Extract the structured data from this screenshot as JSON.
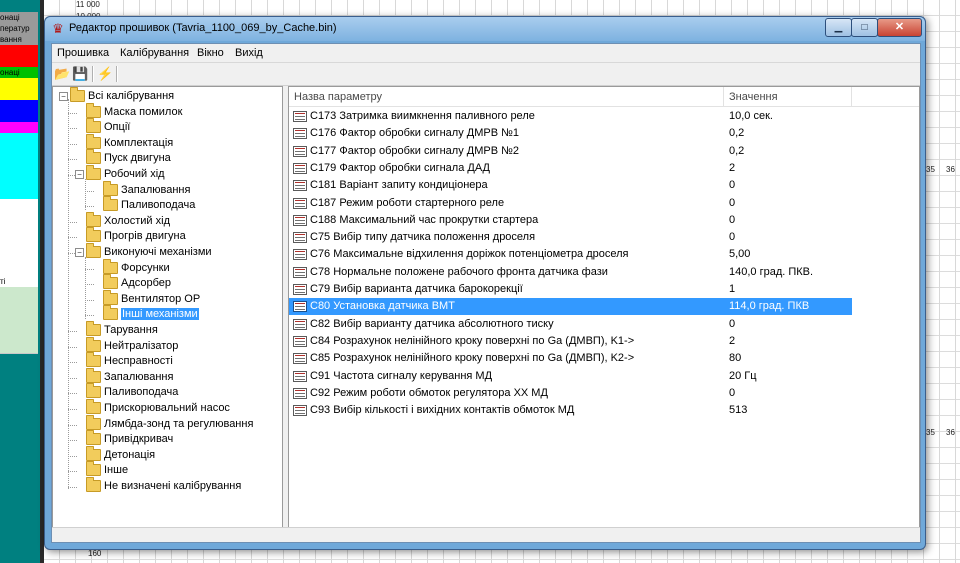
{
  "background": {
    "left_panel_labels": [
      "онаці",
      "ператур",
      "вання",
      "",
      "",
      "онаці",
      "",
      "",
      "",
      "",
      "",
      "",
      "",
      "",
      "",
      "",
      "",
      "",
      "",
      "",
      "",
      "",
      "",
      "",
      "ті"
    ],
    "chart_y_labels": [
      "11 000",
      "10 000",
      "160"
    ],
    "chart_x_ticks": [
      "35",
      "36",
      "35",
      "36"
    ]
  },
  "window": {
    "title": "Редактор прошивок (Tavria_1100_069_by_Cache.bin)",
    "icon": "app-logo-icon",
    "controls": {
      "minimize": "▁",
      "maximize": "□",
      "close": "✕"
    }
  },
  "menu": [
    "Прошивка",
    "Калібрування",
    "Вікно",
    "Вихід"
  ],
  "toolbar": [
    "open-folder-icon",
    "save-icon",
    "flash-icon"
  ],
  "tree": {
    "root": "Всі калібрування",
    "items": [
      {
        "label": "Маска помилок",
        "level": 1
      },
      {
        "label": "Опції",
        "level": 1
      },
      {
        "label": "Комплектація",
        "level": 1
      },
      {
        "label": "Пуск двигуна",
        "level": 1
      },
      {
        "label": "Робочий хід",
        "level": 1,
        "expanded": true
      },
      {
        "label": "Запалювання",
        "level": 2
      },
      {
        "label": "Паливоподача",
        "level": 2
      },
      {
        "label": "Холостий хід",
        "level": 1
      },
      {
        "label": "Прогрів двигуна",
        "level": 1
      },
      {
        "label": "Виконуючі механізми",
        "level": 1,
        "expanded": true
      },
      {
        "label": "Форсунки",
        "level": 2
      },
      {
        "label": "Адсорбер",
        "level": 2
      },
      {
        "label": "Вентилятор ОР",
        "level": 2
      },
      {
        "label": "Інші механізми",
        "level": 2,
        "selected": true
      },
      {
        "label": "Тарування",
        "level": 1
      },
      {
        "label": "Нейтралізатор",
        "level": 1
      },
      {
        "label": "Несправності",
        "level": 1
      },
      {
        "label": "Запалювання",
        "level": 1
      },
      {
        "label": "Паливоподача",
        "level": 1
      },
      {
        "label": "Прискорювальний насос",
        "level": 1
      },
      {
        "label": "Лямбда-зонд та регулювання",
        "level": 1
      },
      {
        "label": "Привідкривач",
        "level": 1
      },
      {
        "label": "Детонація",
        "level": 1
      },
      {
        "label": "Інше",
        "level": 1
      },
      {
        "label": "Не визначені калібрування",
        "level": 1
      }
    ]
  },
  "list": {
    "columns": [
      "Назва параметру",
      "Значення"
    ],
    "rows": [
      {
        "name": "C173 Затримка виимкнення паливного реле",
        "value": "10,0 сек."
      },
      {
        "name": "C176 Фактор обробки сигналу ДМРВ №1",
        "value": "0,2"
      },
      {
        "name": "C177 Фактор обробки сигналу ДМРВ №2",
        "value": "0,2"
      },
      {
        "name": "C179 Фактор обробки сигнала ДАД",
        "value": "2"
      },
      {
        "name": "C181 Варіант запиту кондиціонера",
        "value": "0"
      },
      {
        "name": "C187 Режим роботи стартерного реле",
        "value": "0"
      },
      {
        "name": "C188 Максимальний час прокрутки стартера",
        "value": "0"
      },
      {
        "name": "C75 Вибір типу датчика положення дроселя",
        "value": "0"
      },
      {
        "name": "C76 Максимальне відхилення доріжок потенціометра дроселя",
        "value": "5,00"
      },
      {
        "name": "C78 Нормальне положене рабочого фронта датчика фази",
        "value": "140,0 град. ПКВ."
      },
      {
        "name": "C79 Вибір варианта датчика барокорекції",
        "value": "1"
      },
      {
        "name": "C80 Установка датчика ВМТ",
        "value": "114,0 град. ПКВ",
        "selected": true
      },
      {
        "name": "C82 Вибір варианту датчика абсолютного тиску",
        "value": "0"
      },
      {
        "name": "C84 Розрахунок нелінійного кроку поверхні по Ga (ДМВП), K1->",
        "value": "2"
      },
      {
        "name": "C85 Розрахунок нелінійного кроку поверхні по Ga (ДМВП), K2->",
        "value": "80"
      },
      {
        "name": "C91 Частота сигналу керування МД",
        "value": "20 Гц"
      },
      {
        "name": "C92 Режим роботи обмоток регулятора ХХ МД",
        "value": "0"
      },
      {
        "name": "C93 Вибір кількості і вихідних контактів обмоток МД",
        "value": "513"
      }
    ]
  },
  "colors": {
    "selection": "#3399ff",
    "title_bar": "#7eb2e0",
    "teal_panel": "#008080"
  }
}
